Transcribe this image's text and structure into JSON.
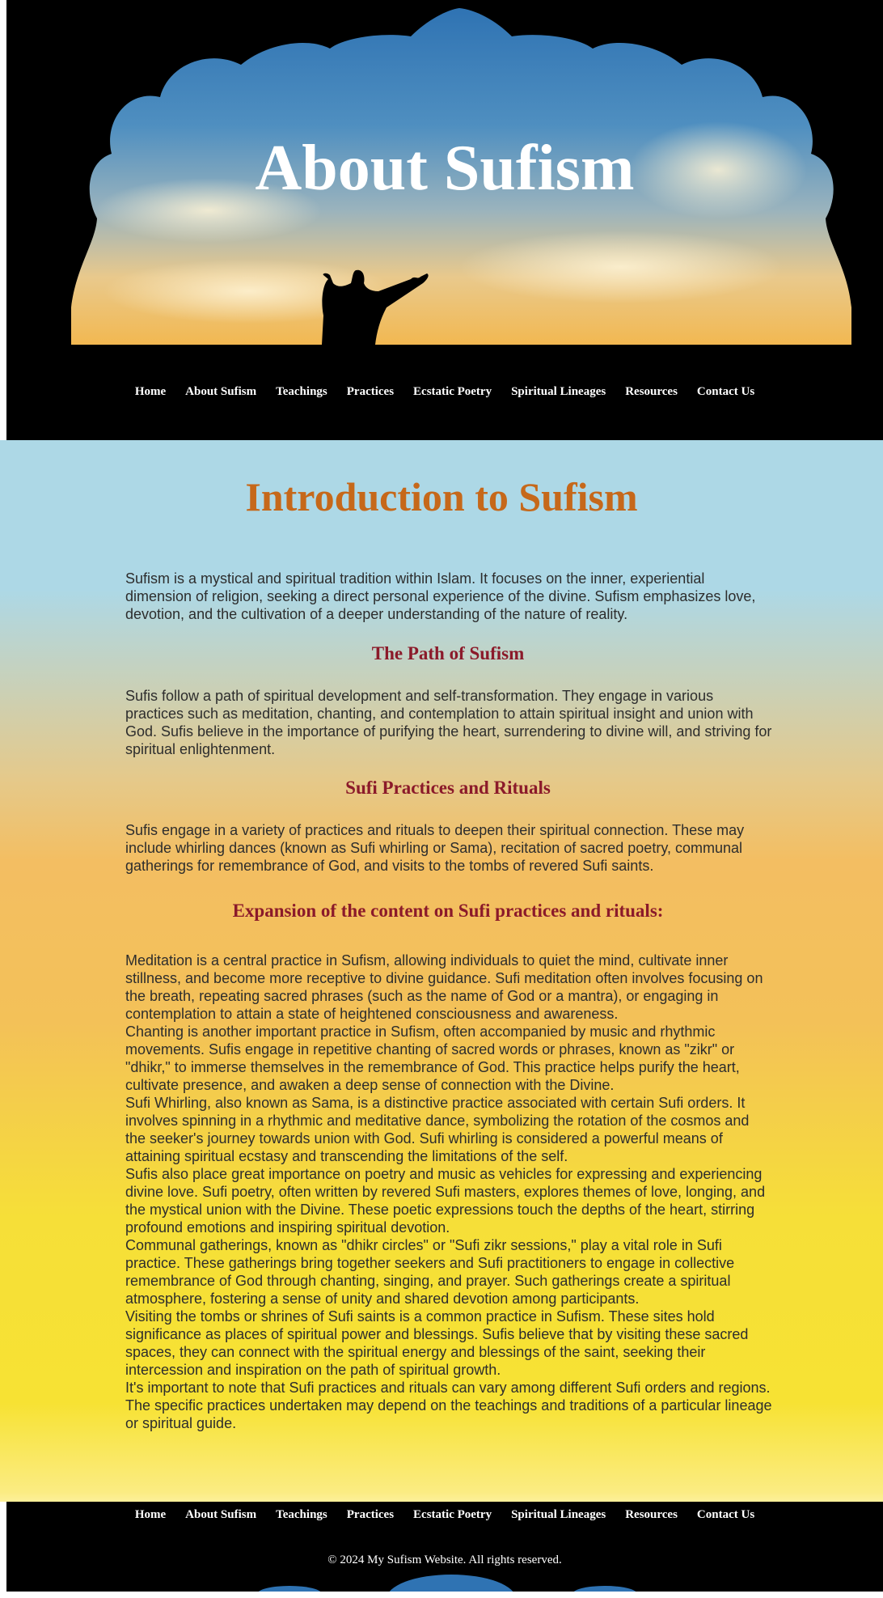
{
  "hero": {
    "title": "About Sufism"
  },
  "nav": {
    "items": [
      {
        "label": "Home"
      },
      {
        "label": "About Sufism"
      },
      {
        "label": "Teachings"
      },
      {
        "label": "Practices"
      },
      {
        "label": "Ecstatic Poetry"
      },
      {
        "label": "Spiritual Lineages"
      },
      {
        "label": "Resources"
      },
      {
        "label": "Contact Us"
      }
    ]
  },
  "main": {
    "title": "Introduction to Sufism",
    "intro": "Sufism is a mystical and spiritual tradition within Islam. It focuses on the inner, experiential dimension of religion, seeking a direct personal experience of the divine. Sufism emphasizes love, devotion, and the cultivation of a deeper understanding of the nature of reality.",
    "path_heading": "The Path of Sufism",
    "path_text": "Sufis follow a path of spiritual development and self-transformation. They engage in various practices such as meditation, chanting, and contemplation to attain spiritual insight and union with God. Sufis believe in the importance of purifying the heart, surrendering to divine will, and striving for spiritual enlightenment.",
    "practices_heading": "Sufi Practices and Rituals",
    "practices_text": "Sufis engage in a variety of practices and rituals to deepen their spiritual connection. These may include whirling dances (known as Sufi whirling or Sama), recitation of sacred poetry, communal gatherings for remembrance of God, and visits to the tombs of revered Sufi saints.",
    "expansion_heading": "Expansion of the content on Sufi practices and rituals:",
    "expansion_paragraphs": [
      "Meditation is a central practice in Sufism, allowing individuals to quiet the mind, cultivate inner stillness, and become more receptive to divine guidance. Sufi meditation often involves focusing on the breath, repeating sacred phrases (such as the name of God or a mantra), or engaging in contemplation to attain a state of heightened consciousness and awareness.",
      "Chanting is another important practice in Sufism, often accompanied by music and rhythmic movements. Sufis engage in repetitive chanting of sacred words or phrases, known as \"zikr\" or \"dhikr,\" to immerse themselves in the remembrance of God. This practice helps purify the heart, cultivate presence, and awaken a deep sense of connection with the Divine.",
      "Sufi Whirling, also known as Sama, is a distinctive practice associated with certain Sufi orders. It involves spinning in a rhythmic and meditative dance, symbolizing the rotation of the cosmos and the seeker's journey towards union with God. Sufi whirling is considered a powerful means of attaining spiritual ecstasy and transcending the limitations of the self.",
      "Sufis also place great importance on poetry and music as vehicles for expressing and experiencing divine love. Sufi poetry, often written by revered Sufi masters, explores themes of love, longing, and the mystical union with the Divine. These poetic expressions touch the depths of the heart, stirring profound emotions and inspiring spiritual devotion.",
      "Communal gatherings, known as \"dhikr circles\" or \"Sufi zikr sessions,\" play a vital role in Sufi practice. These gatherings bring together seekers and Sufi practitioners to engage in collective remembrance of God through chanting, singing, and prayer. Such gatherings create a spiritual atmosphere, fostering a sense of unity and shared devotion among participants.",
      "Visiting the tombs or shrines of Sufi saints is a common practice in Sufism. These sites hold significance as places of spiritual power and blessings. Sufis believe that by visiting these sacred spaces, they can connect with the spiritual energy and blessings of the saint, seeking their intercession and inspiration on the path of spiritual growth.",
      "It's important to note that Sufi practices and rituals can vary among different Sufi orders and regions. The specific practices undertaken may depend on the teachings and traditions of a particular lineage or spiritual guide."
    ]
  },
  "footer": {
    "nav": [
      {
        "label": "Home"
      },
      {
        "label": "About Sufism"
      },
      {
        "label": "Teachings"
      },
      {
        "label": "Practices"
      },
      {
        "label": "Ecstatic Poetry"
      },
      {
        "label": "Spiritual Lineages"
      },
      {
        "label": "Resources"
      },
      {
        "label": "Contact Us"
      }
    ],
    "copyright": "© 2024 My Sufism Website. All rights reserved."
  },
  "colors": {
    "title": "#c6681a",
    "heading": "#8b1a2a",
    "header_bg": "#000000"
  }
}
